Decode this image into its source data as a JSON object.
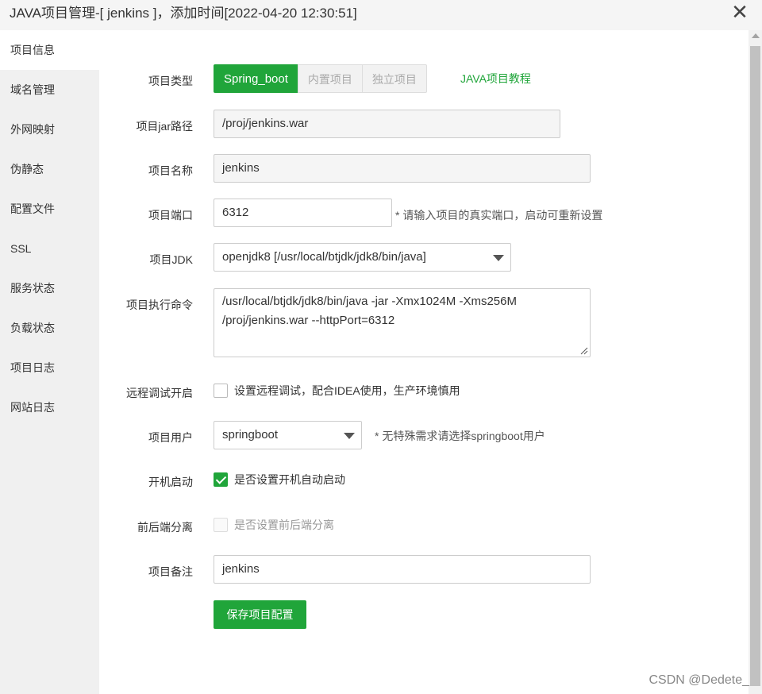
{
  "window": {
    "title": "JAVA项目管理-[ jenkins ]，添加时间[2022-04-20 12:30:51]",
    "close_glyph": "✕",
    "close_icon": "close-icon"
  },
  "sidebar": {
    "items": [
      {
        "label": "项目信息",
        "active": true
      },
      {
        "label": "域名管理"
      },
      {
        "label": "外网映射"
      },
      {
        "label": "伪静态"
      },
      {
        "label": "配置文件"
      },
      {
        "label": "SSL"
      },
      {
        "label": "服务状态"
      },
      {
        "label": "负载状态"
      },
      {
        "label": "项目日志"
      },
      {
        "label": "网站日志"
      }
    ]
  },
  "form": {
    "project_type": {
      "label": "项目类型",
      "options": [
        "Spring_boot",
        "内置项目",
        "独立项目"
      ],
      "selected": "Spring_boot",
      "tutorial_link": "JAVA项目教程"
    },
    "jar_path": {
      "label": "项目jar路径",
      "value": "/proj/jenkins.war"
    },
    "project_name": {
      "label": "项目名称",
      "value": "jenkins"
    },
    "project_port": {
      "label": "项目端口",
      "value": "6312",
      "hint": "* 请输入项目的真实端口，启动可重新设置"
    },
    "project_jdk": {
      "label": "项目JDK",
      "value": "openjdk8 [/usr/local/btjdk/jdk8/bin/java]"
    },
    "exec_command": {
      "label": "项目执行命令",
      "line1": "/usr/local/btjdk/jdk8/bin/java -jar -Xmx1024M -Xms256M",
      "line2": "/proj/jenkins.war --httpPort=6312"
    },
    "remote_debug": {
      "label": "远程调试开启",
      "text": "设置远程调试，配合IDEA使用，生产环境慎用",
      "checked": false
    },
    "project_user": {
      "label": "项目用户",
      "value": "springboot",
      "hint": "* 无特殊需求请选择springboot用户"
    },
    "autostart": {
      "label": "开机启动",
      "text": "是否设置开机自动启动",
      "checked": true
    },
    "separation": {
      "label": "前后端分离",
      "text": "是否设置前后端分离",
      "checked": false,
      "disabled": true
    },
    "remark": {
      "label": "项目备注",
      "value": "jenkins"
    },
    "save_label": "保存项目配置"
  },
  "watermark": "CSDN @Dedete_",
  "colors": {
    "accent": "#20a53a",
    "sidebar_bg": "#f0f0f0",
    "titlebar_bg": "#f5f5f5"
  }
}
